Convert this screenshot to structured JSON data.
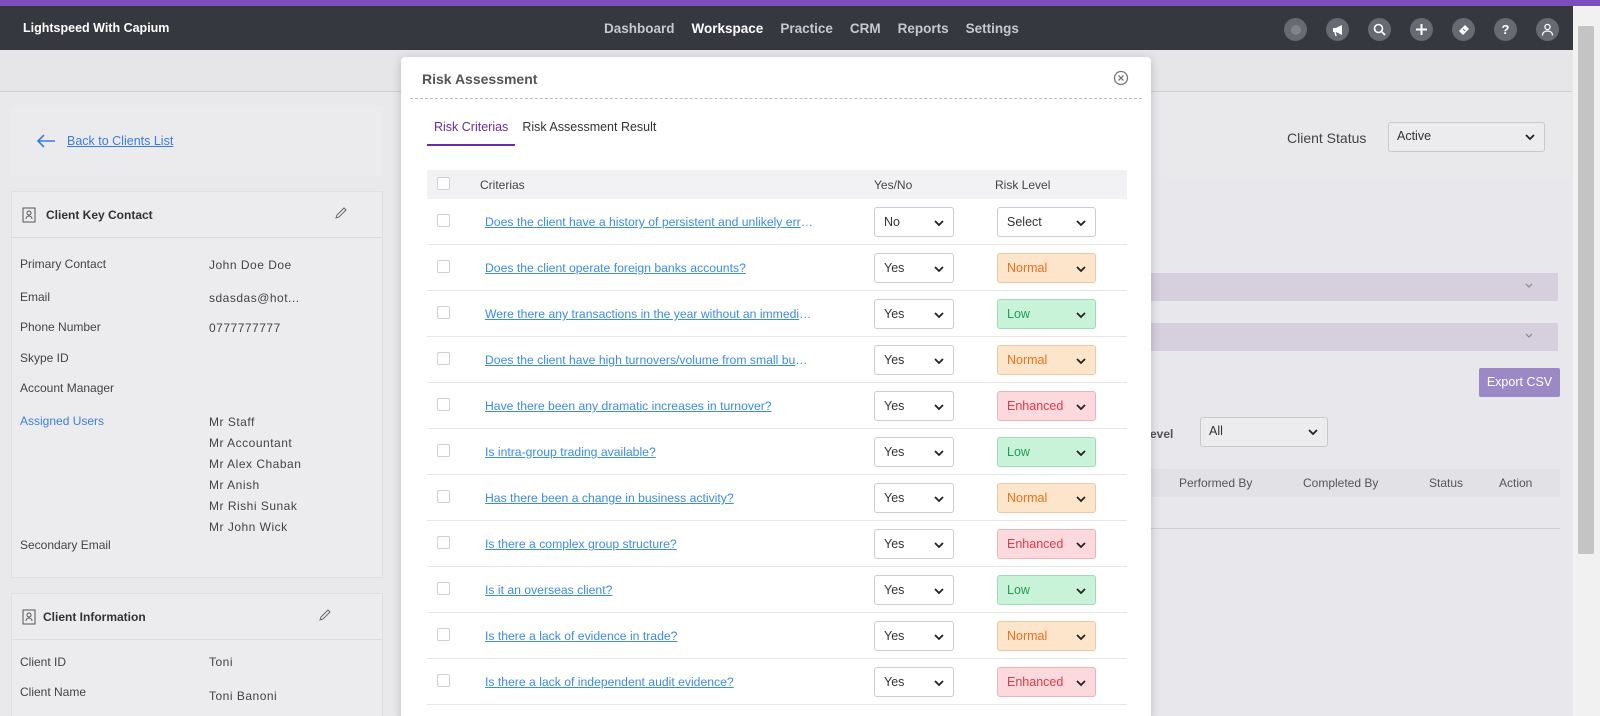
{
  "brand": "Lightspeed With Capium",
  "nav": {
    "items": [
      "Dashboard",
      "Workspace",
      "Practice",
      "CRM",
      "Reports",
      "Settings"
    ],
    "active": "Workspace"
  },
  "nav_icons": [
    "status-dot-icon",
    "megaphone-icon",
    "search-icon",
    "plus-icon",
    "ticket-icon",
    "help-icon",
    "user-icon"
  ],
  "back_link": "Back to Clients List",
  "client_status": {
    "label": "Client Status",
    "value": "Active"
  },
  "key_contact": {
    "title": "Client Key Contact",
    "fields": [
      {
        "label": "Primary Contact",
        "value": "John Doe Doe"
      },
      {
        "label": "Email",
        "value": "sdasdas@hot..."
      },
      {
        "label": "Phone Number",
        "value": "0777777777"
      },
      {
        "label": "Skype ID",
        "value": ""
      },
      {
        "label": "Account Manager",
        "value": ""
      }
    ],
    "assigned_users_label": "Assigned Users",
    "assigned_users": [
      "Mr Staff",
      "Mr Accountant",
      "Mr Alex Chaban",
      "Mr Anish",
      "Mr Rishi Sunak",
      "Mr John Wick"
    ],
    "secondary_email_label": "Secondary Email"
  },
  "client_info": {
    "title": "Client Information",
    "fields": [
      {
        "label": "Client ID",
        "value": "Toni"
      },
      {
        "label": "Client Name",
        "value": "Toni Banoni"
      }
    ]
  },
  "background_panel": {
    "export_label": "Export CSV",
    "level_label": "evel",
    "level_value": "All",
    "columns": [
      "Performed By",
      "Completed By",
      "Status",
      "Action"
    ]
  },
  "modal": {
    "title": "Risk Assessment",
    "tabs": [
      "Risk Criterias",
      "Risk Assessment Result"
    ],
    "active_tab": "Risk Criterias",
    "columns": {
      "criteria": "Criterias",
      "yesno": "Yes/No",
      "risk": "Risk Level"
    },
    "rows": [
      {
        "criteria": "Does the client have a history of persistent and unlikely errors?",
        "answer": "No",
        "risk": "Select",
        "risk_class": "select"
      },
      {
        "criteria": "Does the client operate foreign banks accounts?",
        "answer": "Yes",
        "risk": "Normal",
        "risk_class": "normal"
      },
      {
        "criteria": "Were there any transactions in the year without an immediate explanation?",
        "answer": "Yes",
        "risk": "Low",
        "risk_class": "low"
      },
      {
        "criteria": "Does the client have high turnovers/volume from small business?",
        "answer": "Yes",
        "risk": "Normal",
        "risk_class": "normal"
      },
      {
        "criteria": "Have there been any dramatic increases in turnover?",
        "answer": "Yes",
        "risk": "Enhanced",
        "risk_class": "enhanced"
      },
      {
        "criteria": "Is intra-group trading available?",
        "answer": "Yes",
        "risk": "Low",
        "risk_class": "low"
      },
      {
        "criteria": "Has there been a change in business activity?",
        "answer": "Yes",
        "risk": "Normal",
        "risk_class": "normal"
      },
      {
        "criteria": "Is there a complex group structure?",
        "answer": "Yes",
        "risk": "Enhanced",
        "risk_class": "enhanced"
      },
      {
        "criteria": "Is it an overseas client?",
        "answer": "Yes",
        "risk": "Low",
        "risk_class": "low"
      },
      {
        "criteria": "Is there a lack of evidence in trade?",
        "answer": "Yes",
        "risk": "Normal",
        "risk_class": "normal"
      },
      {
        "criteria": "Is there a lack of independent audit evidence?",
        "answer": "Yes",
        "risk": "Enhanced",
        "risk_class": "enhanced"
      }
    ]
  },
  "colors": {
    "accent": "#7c4dbd",
    "nav_bg": "#363840",
    "link": "#3b8bea",
    "tab_active": "#6a2ca8"
  }
}
